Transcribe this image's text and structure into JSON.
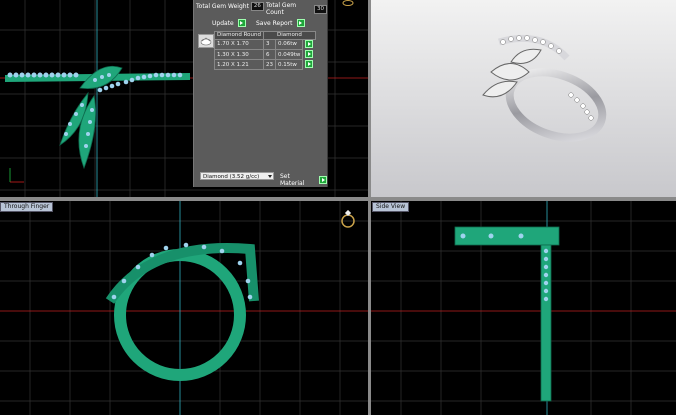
{
  "panel": {
    "total_gem_weight_label": "Total Gem Weight",
    "total_gem_weight_value": "26",
    "total_gem_count_label": "Total Gem Count",
    "total_gem_count_value": "30",
    "update_label": "Update",
    "save_report_label": "Save Report",
    "table_headers": [
      "Diamond Round",
      "Diamond"
    ],
    "rows": [
      {
        "size": "1.70 X 1.70",
        "count": "3",
        "weight": "0.06tw"
      },
      {
        "size": "1.30 X 1.30",
        "count": "6",
        "weight": "0.049tw"
      },
      {
        "size": "1.20 X 1.21",
        "count": "23",
        "weight": "0.15tw"
      }
    ],
    "material_select": "Diamond    (3.52 g/cc)",
    "set_material_label": "Set Material"
  },
  "viewports": {
    "front_label": "Through Finger",
    "side_label": "Side View"
  },
  "colors": {
    "metal": "#1fa67a",
    "gem": "#9fd3ee",
    "grid": "#3a3a3a",
    "axis_red": "#d02020",
    "axis_green": "#20c040",
    "axis_cyan": "#3ad0e0",
    "panel_bg": "#5b5b5b",
    "button_green": "#1fa63a"
  },
  "icons": [
    "ring-icon",
    "select-arrow-icon",
    "go-arrow-icon"
  ]
}
